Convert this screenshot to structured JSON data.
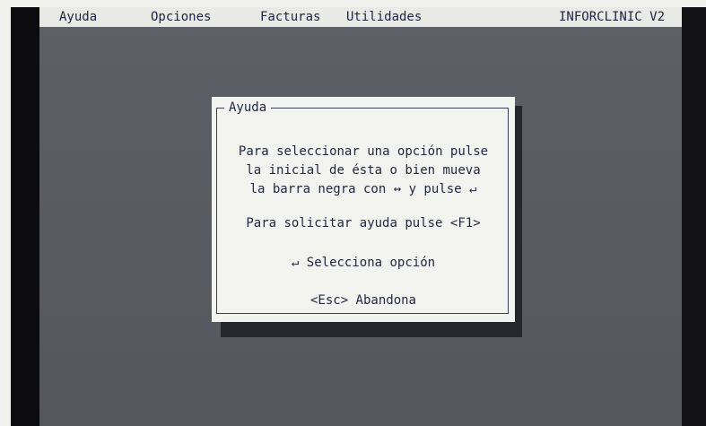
{
  "menu": {
    "items": [
      {
        "label": "Ayuda"
      },
      {
        "label": "Opciones"
      },
      {
        "label": "Facturas"
      },
      {
        "label": "Utilidades"
      }
    ],
    "app_title": "INFORCLINIC V2"
  },
  "dialog": {
    "title": "Ayuda",
    "lines": [
      "Para seleccionar una opción pulse",
      "la inicial de ésta o bien mueva",
      "la barra negra con ↔ y pulse ↵",
      "Para solicitar ayuda pulse <F1>",
      "↵ Selecciona opción",
      "<Esc> Abandona"
    ]
  },
  "colors": {
    "screen_background": "#5a5c63",
    "menu_bar": "#e9e9e6",
    "menu_text": "#1d2340",
    "dialog_background": "#f3f3f0",
    "dialog_shadow": "#26272c"
  }
}
